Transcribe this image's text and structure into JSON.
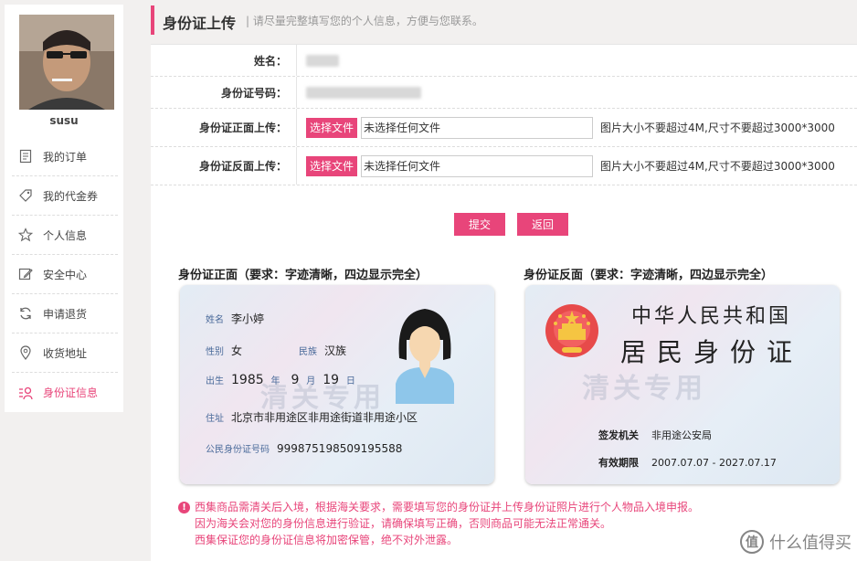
{
  "sidebar": {
    "username": "susu",
    "items": [
      {
        "label": "我的订单",
        "icon": "document-icon"
      },
      {
        "label": "我的代金券",
        "icon": "tag-icon"
      },
      {
        "label": "个人信息",
        "icon": "star-icon"
      },
      {
        "label": "安全中心",
        "icon": "edit-icon"
      },
      {
        "label": "申请退货",
        "icon": "refresh-icon"
      },
      {
        "label": "收货地址",
        "icon": "location-icon"
      },
      {
        "label": "身份证信息",
        "icon": "id-user-icon",
        "active": true
      }
    ]
  },
  "header": {
    "title": "身份证上传",
    "subtitle": "| 请尽量完整填写您的个人信息，方便与您联系。"
  },
  "form": {
    "name_label": "姓名：",
    "id_label": "身份证号码：",
    "front_label": "身份证正面上传：",
    "back_label": "身份证反面上传：",
    "choose_file": "选择文件",
    "no_file": "未选择任何文件",
    "size_hint": "图片大小不要超过4M,尺寸不要超过3000*3000"
  },
  "buttons": {
    "submit": "提交",
    "back": "返回"
  },
  "front_card": {
    "title": "身份证正面（要求：字迹清晰，四边显示完全）",
    "name_k": "姓名",
    "name_v": "李小婷",
    "sex_k": "性别",
    "sex_v": "女",
    "nation_k": "民族",
    "nation_v": "汉族",
    "birth_k": "出生",
    "birth_year": "1985",
    "year_u": "年",
    "birth_month": "9",
    "month_u": "月",
    "birth_day": "19",
    "day_u": "日",
    "addr_k": "住址",
    "addr_v": "北京市非用途区非用途街道非用途小区",
    "idno_k": "公民身份证号码",
    "idno_v": "999875198509195588",
    "watermark": "清关专用"
  },
  "back_card": {
    "title": "身份证反面（要求：字迹清晰，四边显示完全）",
    "country": "中华人民共和国",
    "card_name": "居民身份证",
    "issuer_k": "签发机关",
    "issuer_v": "非用途公安局",
    "valid_k": "有效期限",
    "valid_v": "2007.07.07 - 2027.07.17",
    "watermark": "清关专用"
  },
  "notice": {
    "icon": "!",
    "lines": [
      "西集商品需清关后入境，根据海关要求，需要填写您的身份证并上传身份证照片进行个人物品入境申报。",
      "因为海关会对您的身份信息进行验证，请确保填写正确，否则商品可能无法正常通关。",
      "西集保证您的身份证信息将加密保管，绝不对外泄露。"
    ]
  },
  "brand": {
    "logo": "值",
    "text": "什么值得买"
  },
  "colors": {
    "accent": "#e8457a",
    "page_bg": "#f2f0ef"
  }
}
